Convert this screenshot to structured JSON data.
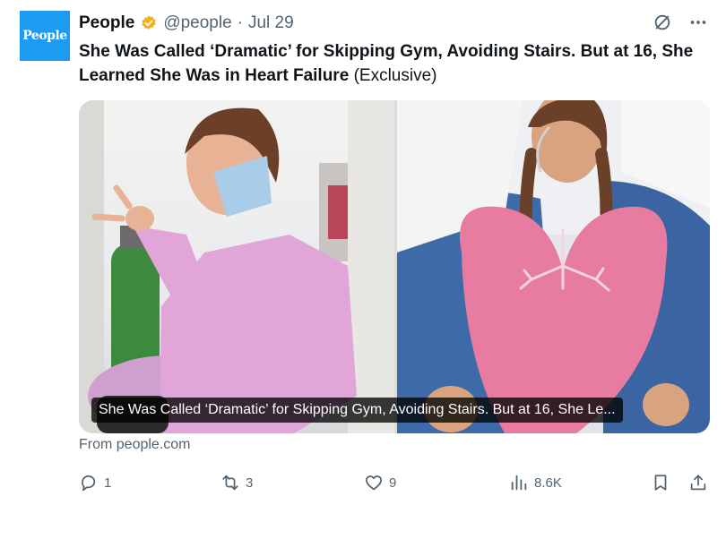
{
  "author": {
    "avatar_text": "People",
    "name": "People",
    "handle": "@people",
    "separator": "·",
    "date": "Jul 29"
  },
  "tweet": {
    "title": "She Was Called ‘Dramatic’ for Skipping Gym, Avoiding Stairs. But at 16, She Learned She Was in Heart Failure",
    "title_suffix": "(Exclusive)"
  },
  "card": {
    "caption": "She Was Called ‘Dramatic’ for Skipping Gym, Avoiding Stairs. But at 16, She Le...",
    "source": "From people.com"
  },
  "actions": {
    "replies": "1",
    "retweets": "3",
    "likes": "9",
    "views": "8.6K"
  },
  "colors": {
    "verified_gold": "#f2b01e",
    "avatar_blue": "#1d9bf0",
    "sweatsuit_pink": "#e1a5d8",
    "pillow_pink": "#e87ba0"
  }
}
